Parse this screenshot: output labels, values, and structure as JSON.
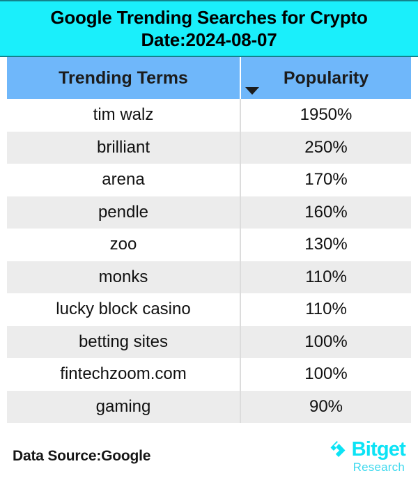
{
  "banner": {
    "title_line1": "Google Trending Searches for Crypto",
    "title_line2": "Date:2024-08-07",
    "background_color": "#1aeffb"
  },
  "table": {
    "header_background_color": "#6fb7fa",
    "columns": [
      {
        "label": "Trending Terms",
        "key": "term"
      },
      {
        "label": "Popularity",
        "key": "popularity"
      }
    ],
    "sort_indicator_icon": "sort-descending-arrow-icon",
    "rows": [
      {
        "term": "tim walz",
        "popularity": "1950%"
      },
      {
        "term": "brilliant",
        "popularity": "250%"
      },
      {
        "term": "arena",
        "popularity": "170%"
      },
      {
        "term": "pendle",
        "popularity": "160%"
      },
      {
        "term": "zoo",
        "popularity": "130%"
      },
      {
        "term": "monks",
        "popularity": "110%"
      },
      {
        "term": "lucky block casino",
        "popularity": "110%"
      },
      {
        "term": "betting sites",
        "popularity": "100%"
      },
      {
        "term": "fintechzoom.com",
        "popularity": "100%"
      },
      {
        "term": "gaming",
        "popularity": "90%"
      }
    ]
  },
  "footer": {
    "data_source": "Data Source:Google",
    "brand_name": "Bitget",
    "brand_subtitle": "Research",
    "brand_logo_icon": "bitget-chevron-logo-icon",
    "brand_color": "#0ce3f5"
  },
  "chart_data": {
    "type": "table",
    "title": "Google Trending Searches for Crypto",
    "subtitle": "Date:2024-08-07",
    "categories": [
      "tim walz",
      "brilliant",
      "arena",
      "pendle",
      "zoo",
      "monks",
      "lucky block casino",
      "betting sites",
      "fintechzoom.com",
      "gaming"
    ],
    "values": [
      1950,
      250,
      170,
      160,
      130,
      110,
      110,
      100,
      100,
      90
    ],
    "xlabel": "Trending Terms",
    "ylabel": "Popularity",
    "unit": "%",
    "sorted": "descending",
    "source": "Google"
  }
}
